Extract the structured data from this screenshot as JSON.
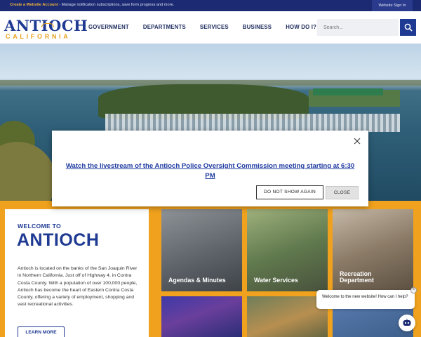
{
  "topbar": {
    "notice_link": "Create a Website Account",
    "notice_text": " - Manage notification subscriptions, save form progress and more.",
    "sign_in": "Website Sign In"
  },
  "logo": {
    "line1": "ANTIOCH",
    "line2": "CALIFORNIA"
  },
  "nav": {
    "items": [
      "GOVERNMENT",
      "DEPARTMENTS",
      "SERVICES",
      "BUSINESS",
      "HOW DO I?"
    ]
  },
  "search": {
    "placeholder": "Search..."
  },
  "welcome": {
    "kicker": "WELCOME TO",
    "title": "ANTIOCH",
    "body": "Antioch is located on the banks of the San Joaquin River in Northern California. Just off of Highway 4, in Contra Costa County. With a population of over 100,000 people, Antioch has become the heart of Eastern Contra Costa County, offering a variety of employment, shopping and vast recreational activities.",
    "learn_more": "LEARN MORE"
  },
  "tiles": [
    {
      "label": "Agendas & Minutes"
    },
    {
      "label": "Water Services"
    },
    {
      "label": "Recreation Department"
    }
  ],
  "modal": {
    "message": "Watch the livestream of the Antioch Police Oversight Commission meeting starting at 6:30 PM",
    "dont_show": "DO NOT SHOW AGAIN",
    "close": "CLOSE"
  },
  "chat": {
    "greeting": "Welcome to the new website! How can I help?",
    "dismiss": "×"
  },
  "colors": {
    "brand_blue": "#1f3a93",
    "accent_gold": "#e9a321",
    "topbar_navy": "#1b2a72"
  }
}
